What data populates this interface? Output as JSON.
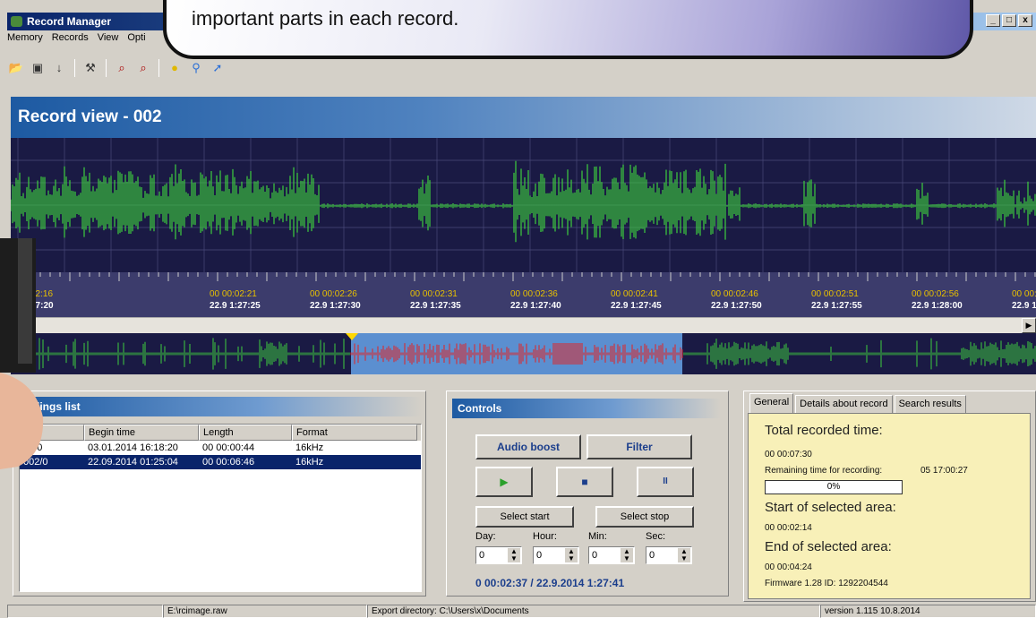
{
  "window": {
    "title": "Record Manager",
    "min": "_",
    "max": "□",
    "close": "x"
  },
  "menu": [
    "Memory",
    "Records",
    "View",
    "Opti"
  ],
  "toolbar_icons": [
    "open-icon",
    "save-icon",
    "download-icon",
    "tools-icon",
    "zoom-in-icon",
    "zoom-out-icon",
    "bulb-icon",
    "search-icon",
    "arrow-icon"
  ],
  "callout": {
    "text": "important parts in each record."
  },
  "record_view": {
    "title": "Record view - 002"
  },
  "timeline": [
    {
      "t": "02:16",
      "d": "27:20"
    },
    {
      "t": "00 00:02:21",
      "d": "22.9 1:27:25"
    },
    {
      "t": "00 00:02:26",
      "d": "22.9 1:27:30"
    },
    {
      "t": "00 00:02:31",
      "d": "22.9 1:27:35"
    },
    {
      "t": "00 00:02:36",
      "d": "22.9 1:27:40"
    },
    {
      "t": "00 00:02:41",
      "d": "22.9 1:27:45"
    },
    {
      "t": "00 00:02:46",
      "d": "22.9 1:27:50"
    },
    {
      "t": "00 00:02:51",
      "d": "22.9 1:27:55"
    },
    {
      "t": "00 00:02:56",
      "d": "22.9 1:28:00"
    },
    {
      "t": "00 00:03:01",
      "d": "22.9 1:28:05"
    },
    {
      "t": "00 0",
      "d": "22.9"
    }
  ],
  "recordings": {
    "title": "ordings list",
    "columns": [
      "er",
      "Begin time",
      "Length",
      "Format"
    ],
    "rows": [
      [
        "01/0",
        "03.01.2014  16:18:20",
        "00 00:00:44",
        "16kHz"
      ],
      [
        "002/0",
        "22.09.2014  01:25:04",
        "00 00:06:46",
        "16kHz"
      ]
    ],
    "selected_row": 1
  },
  "controls": {
    "title": "Controls",
    "audio_boost": "Audio boost",
    "filter": "Filter",
    "play": "▶",
    "stop": "■",
    "pause": "II",
    "select_start": "Select start",
    "select_stop": "Select stop",
    "day_label": "Day:",
    "hour_label": "Hour:",
    "min_label": "Min:",
    "sec_label": "Sec:",
    "day": "0",
    "hour": "0",
    "min": "0",
    "sec": "0",
    "time": "0 00:02:37 / 22.9.2014 1:27:41"
  },
  "info": {
    "tabs": [
      "General",
      "Details about record",
      "Search results"
    ],
    "total_label": "Total recorded time:",
    "total": "00 00:07:30",
    "remaining_label": "Remaining time for recording:",
    "remaining": "05 17:00:27",
    "progress": "0%",
    "progress_value": 0,
    "start_label": "Start of selected area:",
    "start": "00 00:02:14",
    "end_label": "End of selected area:",
    "end": "00 00:04:24",
    "firmware": "Firmware 1.28 ID: 1292204544"
  },
  "status": {
    "file": "E:\\rcimage.raw",
    "export": "Export directory: C:\\Users\\x\\Documents",
    "version": "version 1.115 10.8.2014"
  },
  "colors": {
    "wave": "#3ecf3e",
    "selection_wave": "#e52020",
    "selection_bg": "#5b8fd0",
    "wave_bg": "#1a1a44"
  }
}
